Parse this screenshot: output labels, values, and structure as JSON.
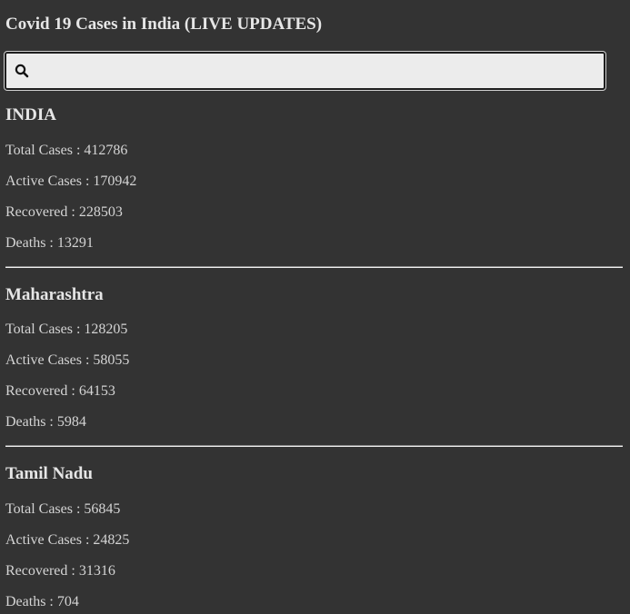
{
  "app": {
    "title": "Covid 19 Cases in India (LIVE UPDATES)"
  },
  "search": {
    "placeholder": "",
    "value": "",
    "icon": "search-icon"
  },
  "regions": [
    {
      "name": "INDIA",
      "total_cases": "Total Cases : 412786",
      "active_cases": "Active Cases : 170942",
      "recovered": "Recovered : 228503",
      "deaths": "Deaths : 13291"
    },
    {
      "name": "Maharashtra",
      "total_cases": "Total Cases : 128205",
      "active_cases": "Active Cases : 58055",
      "recovered": "Recovered : 64153",
      "deaths": "Deaths : 5984"
    },
    {
      "name": "Tamil Nadu",
      "total_cases": "Total Cases : 56845",
      "active_cases": "Active Cases : 24825",
      "recovered": "Recovered : 31316",
      "deaths": "Deaths : 704"
    }
  ],
  "colors": {
    "background": "#333333",
    "text": "#e6e6e6",
    "search_background": "#ececec"
  }
}
